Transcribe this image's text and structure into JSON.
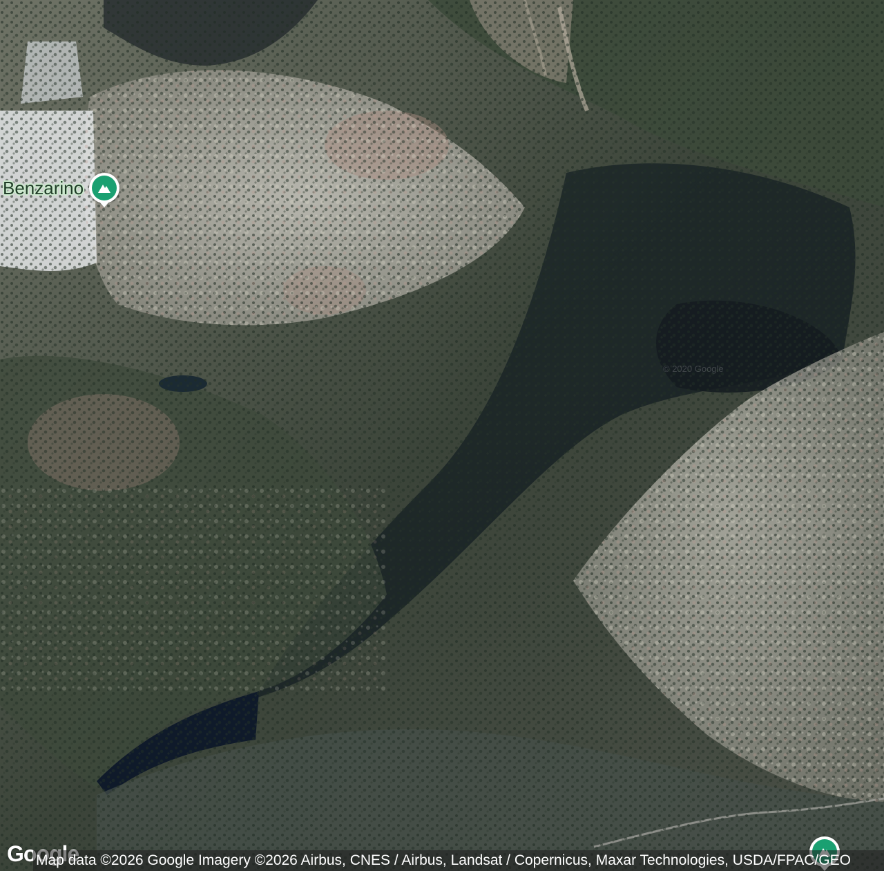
{
  "map": {
    "view": "satellite",
    "watermark": "© 2020 Google",
    "markers": [
      {
        "label": "Benzarino",
        "icon": "mountain-peak-icon",
        "color": "#1aa071"
      },
      {
        "label": "",
        "icon": "mountain-peak-icon",
        "color": "#1aa071"
      }
    ]
  },
  "footer": {
    "logo": "Google",
    "attribution": "Map data ©2026 Google Imagery ©2026 Airbus, CNES / Airbus, Landsat / Copernicus, Maxar Technologies, USDA/FPAC/GEO"
  }
}
